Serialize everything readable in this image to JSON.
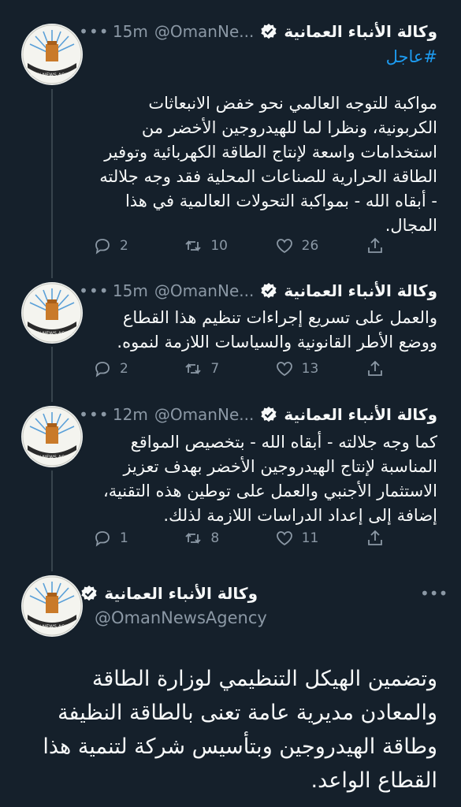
{
  "colors": {
    "background": "#15202b",
    "text": "#f7f9f9",
    "secondary": "#8b98a5",
    "accent": "#1d9bf0",
    "thread_line": "#38444d"
  },
  "tweets": [
    {
      "name": "وكالة الأنباء العمانية",
      "handle": "@OmanNe...",
      "time": "· 15m",
      "hashtag": "#عاجل",
      "text_lines": [
        "مواكبة للتوجه العالمي نحو خفض الانبعاثات",
        "الكربونية، ونظرا لما للهيدروجين الأخضر من",
        "استخدامات واسعة لإنتاج الطاقة الكهربائية وتوفير",
        "الطاقة الحرارية للصناعات المحلية فقد وجه جلالته",
        "- أبقاه الله - بمواكبة التحولات العالمية في هذا",
        "المجال."
      ],
      "replies": "2",
      "retweets": "10",
      "likes": "26"
    },
    {
      "name": "وكالة الأنباء العمانية",
      "handle": "@OmanNe...",
      "time": "· 15m",
      "text_lines": [
        "والعمل على تسريع إجراءات تنظيم هذا القطاع",
        "ووضع الأطر القانونية والسياسات اللازمة لنموه."
      ],
      "replies": "2",
      "retweets": "7",
      "likes": "13"
    },
    {
      "name": "وكالة الأنباء العمانية",
      "handle": "@OmanNe...",
      "time": "· 12m",
      "text_lines": [
        "كما وجه جلالته - أبقاه الله - بتخصيص المواقع",
        "المناسبة لإنتاج  الهيدروجين الأخضر بهدف تعزيز",
        "الاستثمار الأجنبي والعمل على توطين  هذه التقنية،",
        "إضافة إلى إعداد الدراسات اللازمة لذلك."
      ],
      "replies": "1",
      "retweets": "8",
      "likes": "11"
    }
  ],
  "main_tweet": {
    "name": "وكالة الأنباء العمانية",
    "handle": "@OmanNewsAgency",
    "text_lines": [
      "وتضمين الهيكل  التنظيمي لوزارة الطاقة",
      "والمعادن مديرية عامة تعنى بالطاقة النظيفة",
      "وطاقة  الهيدروجين وبتأسيس شركة لتنمية هذا",
      "القطاع الواعد."
    ]
  },
  "avatar_logo_text": "OMAN NEWS AGENCY",
  "icons": [
    "more-icon",
    "verified-icon",
    "reply-icon",
    "retweet-icon",
    "like-icon",
    "share-icon"
  ]
}
